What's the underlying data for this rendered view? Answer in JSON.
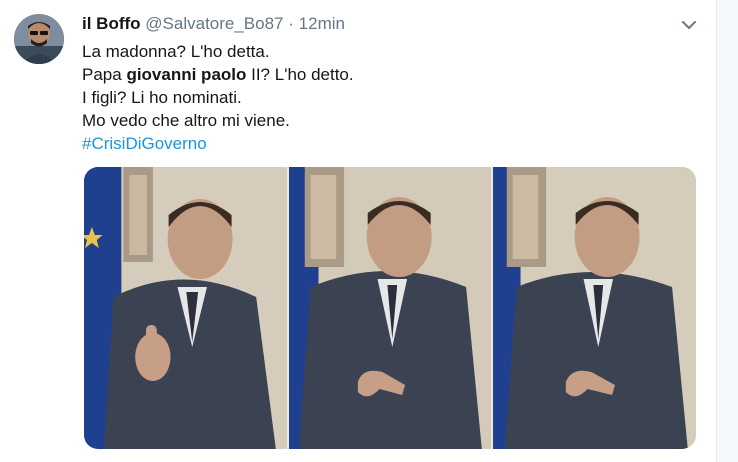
{
  "tweet": {
    "author_name": "il Boffo",
    "handle": "@Salvatore_Bo87",
    "separator": "·",
    "time": "12min",
    "lines": {
      "l1": "La madonna? L'ho detta.",
      "l2_a": "Papa ",
      "l2_b": "giovanni paolo",
      "l2_c": " II? L'ho detto.",
      "l3": "I figli? Li ho nominati.",
      "l4": "Mo vedo che altro mi viene."
    },
    "hashtag": "#CrisiDiGoverno"
  },
  "icons": {
    "caret": "chevron-down-icon",
    "avatar": "user-avatar"
  },
  "colors": {
    "link": "#1b95e0",
    "secondary_text": "#657786",
    "primary_text": "#14171a"
  }
}
